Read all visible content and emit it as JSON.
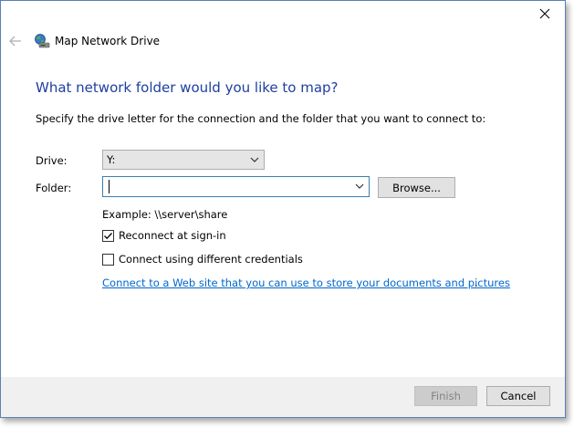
{
  "window": {
    "title": "Map Network Drive"
  },
  "heading": "What network folder would you like to map?",
  "instruction": "Specify the drive letter for the connection and the folder that you want to connect to:",
  "drive": {
    "label": "Drive:",
    "value": "Y:"
  },
  "folder": {
    "label": "Folder:",
    "value": "",
    "browse_label": "Browse..."
  },
  "example": "Example: \\\\server\\share",
  "options": {
    "reconnect_label": "Reconnect at sign-in",
    "reconnect_checked": true,
    "credentials_label": "Connect using different credentials",
    "credentials_checked": false
  },
  "web_link": {
    "text": "Connect to a Web site that you can use to store your documents and pictures",
    "suffix": "."
  },
  "footer": {
    "finish_label": "Finish",
    "cancel_label": "Cancel"
  },
  "icons": {
    "close": "close-icon",
    "back": "back-arrow-icon",
    "title": "network-drive-icon",
    "dropdown": "chevron-down-icon",
    "check": "checkmark-icon"
  },
  "colors": {
    "heading": "#1e3f9f",
    "link": "#0066cc",
    "window_border": "#5b7fb5",
    "footer_bg": "#f0f0f0"
  }
}
